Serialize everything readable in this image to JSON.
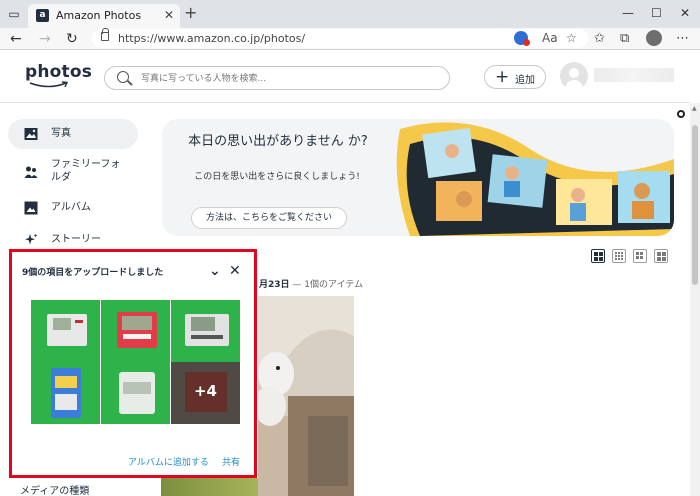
{
  "browser": {
    "tab_title": "Amazon Photos",
    "url": "https://www.amazon.co.jp/photos/"
  },
  "header": {
    "logo_text": "photos",
    "search_placeholder": "写真に写っている人物を検索...",
    "add_label": "追加"
  },
  "sidebar": {
    "items": [
      {
        "label": "写真",
        "icon": "photo-icon",
        "active": true
      },
      {
        "label": "ファミリーフォルダ",
        "icon": "family-icon",
        "active": false
      },
      {
        "label": "アルバム",
        "icon": "album-icon",
        "active": false
      },
      {
        "label": "ストーリー",
        "icon": "sparkle-icon",
        "active": false
      }
    ],
    "media_type_label": "メディアの種類"
  },
  "memories": {
    "title": "本日の思い出がありません か?",
    "subtitle": "この日を思い出をさらに良くしましょう!",
    "button": "方法は、こちらをご覧ください"
  },
  "timeline": {
    "date_label": "月23日",
    "count_label": "— 1個のアイテム"
  },
  "upload_popup": {
    "title": "9個の項目をアップロードしました",
    "more_count": "+4",
    "add_to_album": "アルバムに追加する",
    "share": "共有"
  },
  "colors": {
    "accent": "#1f8ccc",
    "highlight_border": "#e1051e",
    "brand_dark": "#232f3e"
  }
}
